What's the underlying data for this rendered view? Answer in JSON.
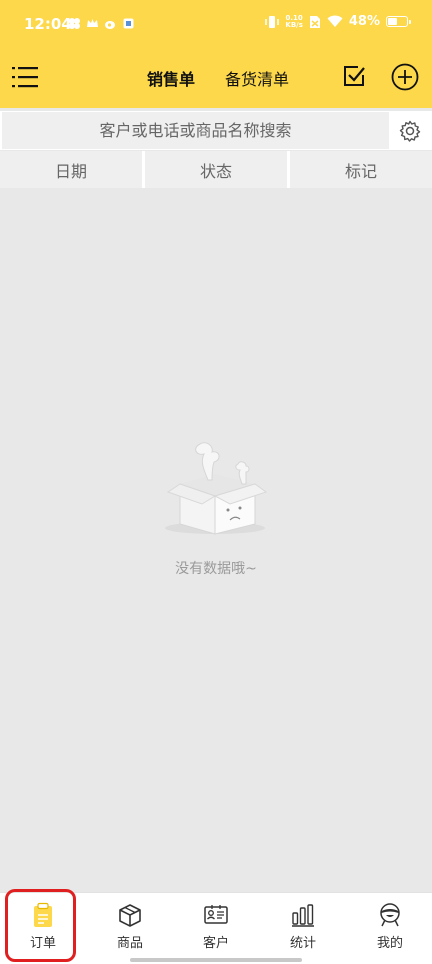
{
  "status_bar": {
    "time": "12:04",
    "net_speed_value": "0.10",
    "net_speed_unit": "KB/s",
    "battery": "48%"
  },
  "toolbar": {
    "tab_sales": "销售单",
    "tab_stock": "备货清单"
  },
  "search": {
    "placeholder": "客户或电话或商品名称搜索"
  },
  "filters": [
    "日期",
    "状态",
    "标记"
  ],
  "empty": {
    "message": "没有数据哦~"
  },
  "nav": {
    "items": [
      {
        "label": "订单",
        "icon": "clipboard-icon",
        "active": true
      },
      {
        "label": "商品",
        "icon": "box-icon",
        "active": false
      },
      {
        "label": "客户",
        "icon": "contact-card-icon",
        "active": false
      },
      {
        "label": "统计",
        "icon": "bar-chart-icon",
        "active": false
      },
      {
        "label": "我的",
        "icon": "user-avatar-icon",
        "active": false
      }
    ]
  },
  "colors": {
    "brand_yellow": "#fcd84a",
    "highlight_red": "#e02020"
  }
}
